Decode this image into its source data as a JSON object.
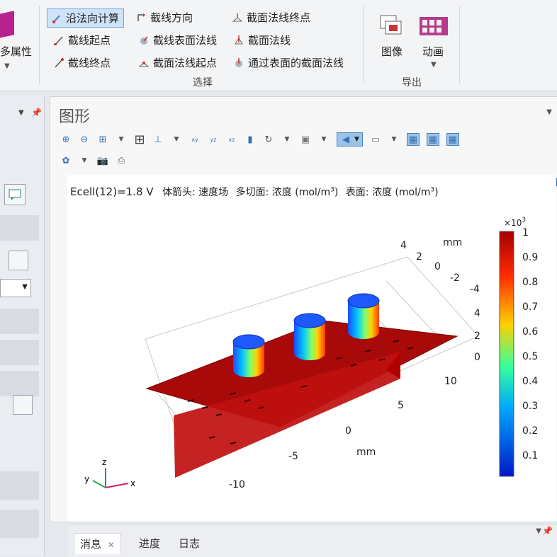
{
  "ribbon": {
    "left_partial_label": "多属性",
    "selection_group": {
      "label": "选择",
      "items": [
        {
          "label": "沿法向计算",
          "active": true
        },
        {
          "label": "截线方向"
        },
        {
          "label": "截面法线终点"
        },
        {
          "label": "截线起点"
        },
        {
          "label": "截线表面法线"
        },
        {
          "label": "截面法线"
        },
        {
          "label": "截线终点"
        },
        {
          "label": "截面法线起点"
        },
        {
          "label": "通过表面的截面法线"
        }
      ]
    },
    "export_group": {
      "label": "导出",
      "items": [
        {
          "label": "图像"
        },
        {
          "label": "动画"
        }
      ]
    }
  },
  "graphics": {
    "title": "图形",
    "info": {
      "ecell": "Ecell(12)=1.8 V",
      "arrow": "体箭头: 速度场",
      "multislice": "多切面: 浓度 (mol/m",
      "multislice_sup": "3",
      "multislice_end": ")",
      "surface": "表面: 浓度 (mol/m",
      "surface_sup": "3",
      "surface_end": ")"
    },
    "plot": {
      "x_ticks": [
        "-10",
        "-5",
        "0",
        "5",
        "10"
      ],
      "x_unit": "mm",
      "y_ticks": [
        "4",
        "2",
        "0",
        "-2",
        "-4"
      ],
      "y_unit": "mm",
      "z_ticks": [
        "4",
        "2",
        "0"
      ],
      "triad": {
        "x": "x",
        "y": "y",
        "z": "z"
      }
    },
    "colorbar": {
      "exponent": "×10",
      "exponent_sup": "3",
      "ticks": [
        "1",
        "0.9",
        "0.8",
        "0.7",
        "0.6",
        "0.5",
        "0.4",
        "0.3",
        "0.2",
        "0.1"
      ],
      "colors": {
        "top": "#a50000",
        "high": "#ff2a00",
        "mid_high": "#ffd000",
        "mid": "#38ff9a",
        "mid_low": "#00a8ff",
        "low": "#0018c8"
      }
    }
  },
  "bottom_tabs": [
    {
      "label": "消息",
      "active": true
    },
    {
      "label": "进度"
    },
    {
      "label": "日志"
    }
  ]
}
